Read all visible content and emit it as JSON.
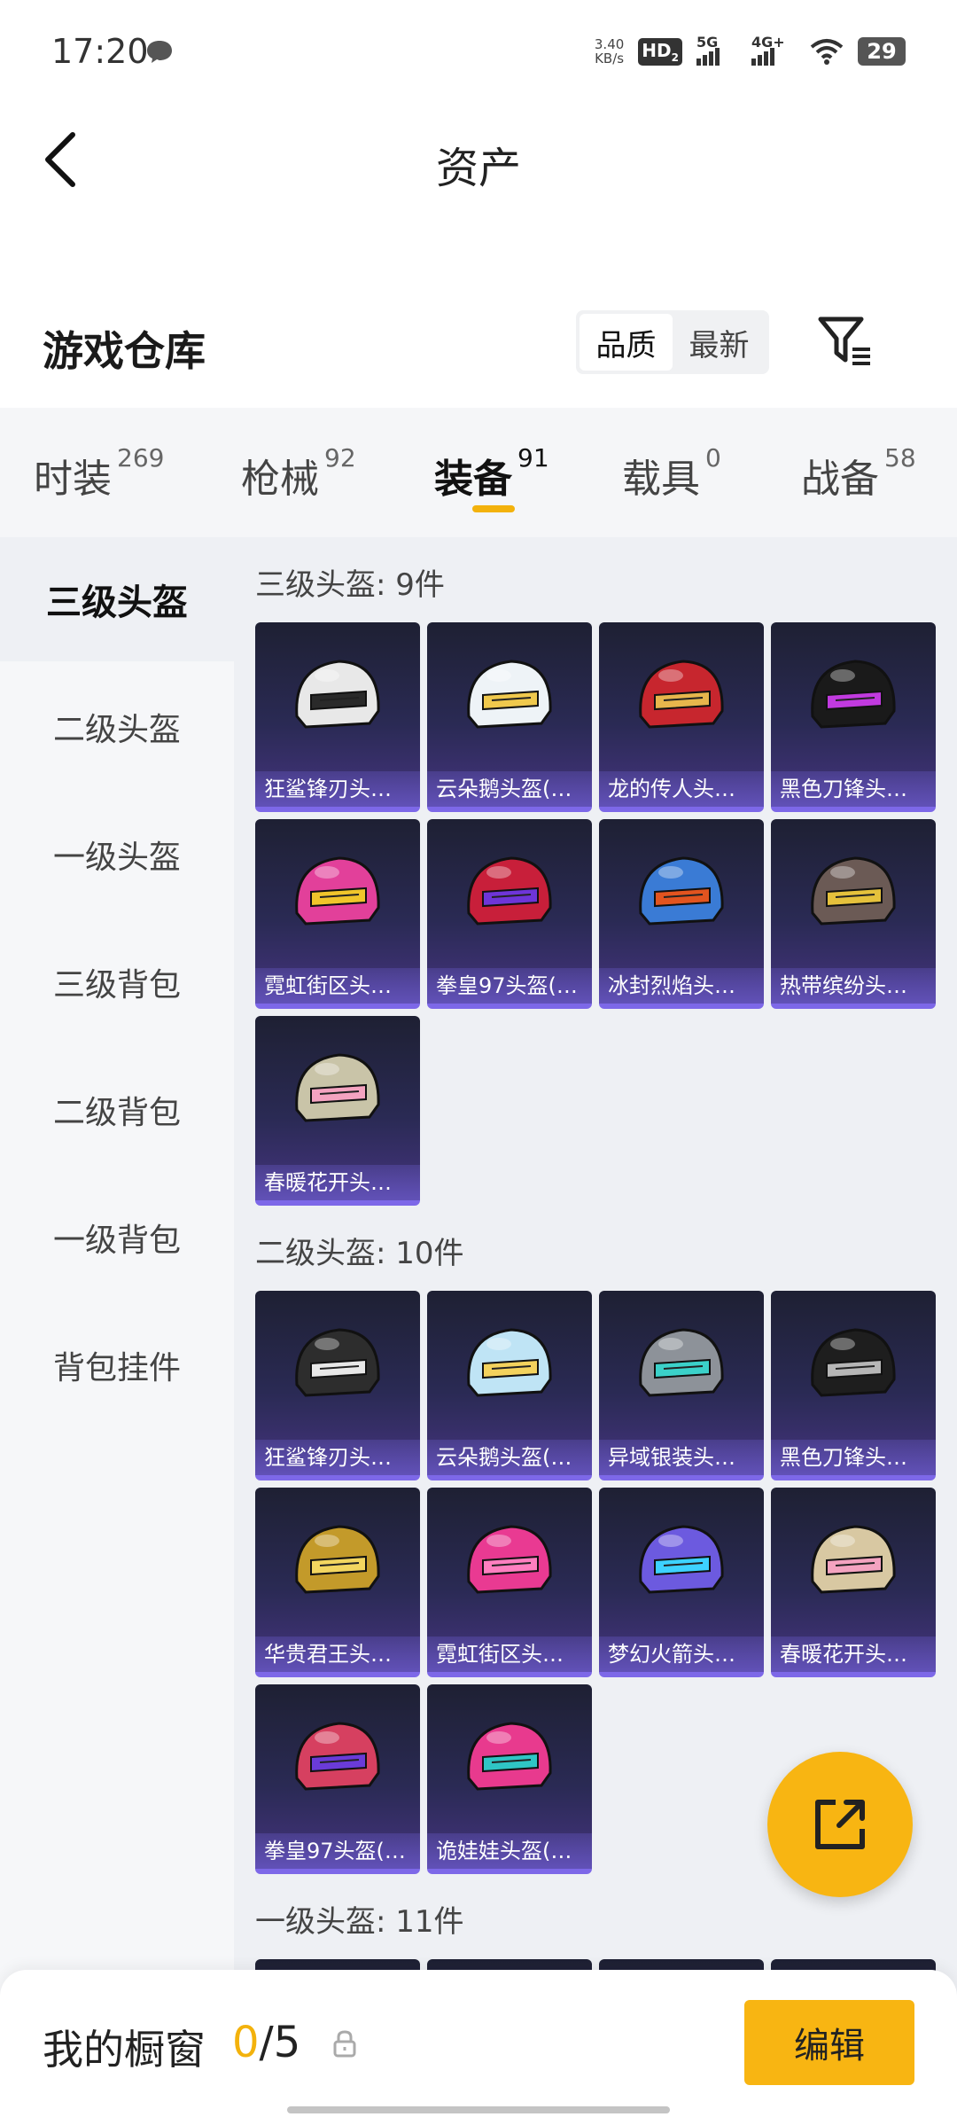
{
  "status_bar": {
    "time": "17:20",
    "net_speed_value": "3.40",
    "net_speed_unit": "KB/s",
    "hd": "HD",
    "hd_sub": "2",
    "sig1": "5G",
    "sig2": "4G+",
    "battery": "29"
  },
  "header": {
    "title": "资产"
  },
  "section": {
    "title": "游戏仓库",
    "sort_options": [
      "品质",
      "最新"
    ]
  },
  "tabs": [
    {
      "label": "时装",
      "count": "269"
    },
    {
      "label": "枪械",
      "count": "92"
    },
    {
      "label": "装备",
      "count": "91"
    },
    {
      "label": "载具",
      "count": "0"
    },
    {
      "label": "战备",
      "count": "58"
    }
  ],
  "sidebar": [
    "三级头盔",
    "二级头盔",
    "一级头盔",
    "三级背包",
    "二级背包",
    "一级背包",
    "背包挂件"
  ],
  "groups": [
    {
      "title": "三级头盔: 9件",
      "items": [
        "狂鲨锋刃头…",
        "云朵鹅头盔(…",
        "龙的传人头…",
        "黑色刀锋头…",
        "霓虹街区头…",
        "拳皇97头盔(…",
        "冰封烈焰头…",
        "热带缤纷头…",
        "春暖花开头…"
      ]
    },
    {
      "title": "二级头盔: 10件",
      "items": [
        "狂鲨锋刃头…",
        "云朵鹅头盔(…",
        "异域银装头…",
        "黑色刀锋头…",
        "华贵君王头…",
        "霓虹街区头…",
        "梦幻火箭头…",
        "春暖花开头…",
        "拳皇97头盔(…",
        "诡娃娃头盔(…"
      ]
    },
    {
      "title": "一级头盔: 11件",
      "items": [
        "",
        "",
        "",
        ""
      ]
    }
  ],
  "bottom_bar": {
    "showcase_label": "我的橱窗",
    "showcase_filled": "0",
    "showcase_total": "/5",
    "edit_label": "编辑"
  },
  "colors": {
    "accent": "#f8b512",
    "card_gradient_top": "#1e2033",
    "card_gradient_bottom": "#45347f",
    "card_border": "#7d68e8"
  },
  "helmet_colors": [
    [
      "#e8e8e8",
      "#2a2a2a"
    ],
    [
      "#eef3f7",
      "#f0c94d"
    ],
    [
      "#c7262e",
      "#e7b64c"
    ],
    [
      "#1a1a1a",
      "#c13adf"
    ],
    [
      "#e2409a",
      "#f0c52b"
    ],
    [
      "#c81f3a",
      "#6e35d8"
    ],
    [
      "#3a7bd5",
      "#e2541f"
    ],
    [
      "#6b5a55",
      "#e5c13c"
    ],
    [
      "#c9c4a8",
      "#f4a3c0"
    ],
    [
      "#2d2d2d",
      "#e8e8e8"
    ],
    [
      "#bfe4f5",
      "#f3d25d"
    ],
    [
      "#8d9299",
      "#3bd1c9"
    ],
    [
      "#1e1e1e",
      "#b6b6b6"
    ],
    [
      "#c39a2a",
      "#f3d660"
    ],
    [
      "#e93a92",
      "#ff7fc0"
    ],
    [
      "#6c5adf",
      "#3dd2ff"
    ],
    [
      "#d8c8a2",
      "#f4a3c0"
    ],
    [
      "#d64060",
      "#6a3bd8"
    ],
    [
      "#e83a8e",
      "#2fc5c5"
    ]
  ]
}
